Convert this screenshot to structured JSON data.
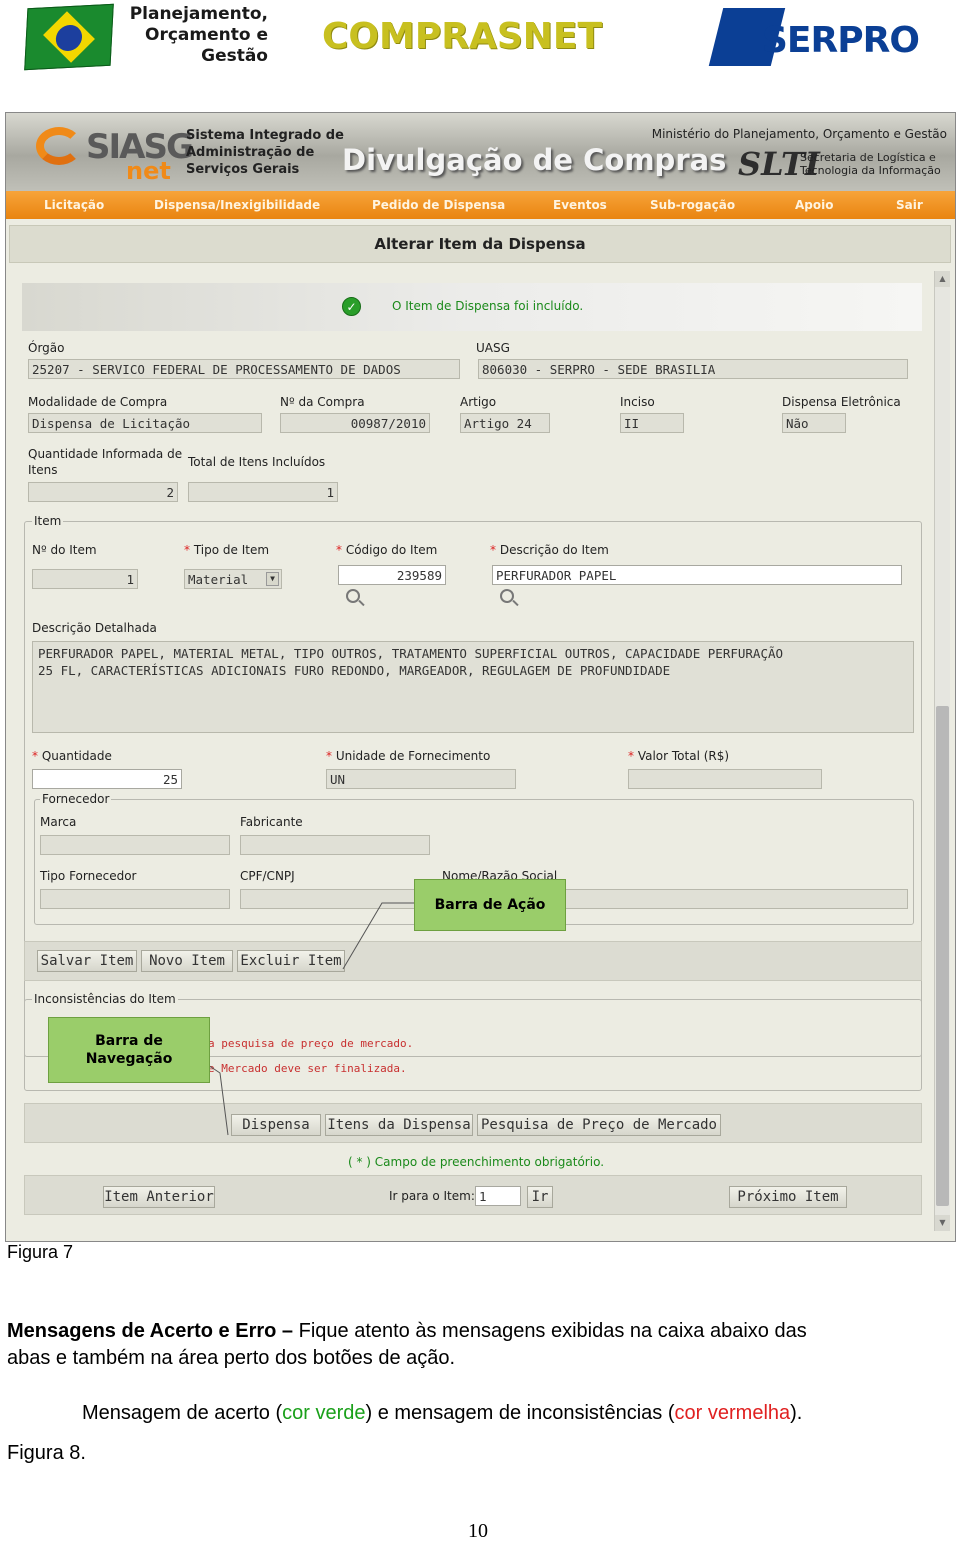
{
  "logos": {
    "mpog_lines": [
      "Planejamento,",
      "Orçamento e",
      "Gestão"
    ],
    "comprasnet": "COMPRASNET",
    "serpro": "SERPRO"
  },
  "banner": {
    "siasg": "SIASG",
    "net": "net",
    "system_name": [
      "Sistema Integrado de",
      "Administração de",
      "Serviços Gerais"
    ],
    "title": "Divulgação de Compras",
    "ministry": "Ministério do Planejamento, Orçamento e Gestão",
    "slti": "SLTI",
    "slti_sub": [
      "Secretaria de Logística e",
      "Tecnologia da Informação"
    ]
  },
  "menu": [
    "Licitação",
    "Dispensa/Inexigibilidade",
    "Pedido de Dispensa",
    "Eventos",
    "Sub-rogação",
    "Apoio",
    "Sair"
  ],
  "page_title": "Alterar Item da Dispensa",
  "success_message": "O Item de Dispensa foi incluído.",
  "form": {
    "orgao_label": "Órgão",
    "orgao_value": "25207 - SERVICO FEDERAL DE PROCESSAMENTO DE DADOS",
    "uasg_label": "UASG",
    "uasg_value": "806030 - SERPRO - SEDE BRASILIA",
    "modalidade_label": "Modalidade de Compra",
    "modalidade_value": "Dispensa de Licitação",
    "numero_label": "Nº da Compra",
    "numero_value": "00987/2010",
    "artigo_label": "Artigo",
    "artigo_value": "Artigo 24",
    "inciso_label": "Inciso",
    "inciso_value": "II",
    "eletronica_label": "Dispensa Eletrônica",
    "eletronica_value": "Não",
    "qtd_informada_label_1": "Quantidade Informada de",
    "qtd_informada_label_2": "Itens",
    "qtd_informada_value": "2",
    "total_incluidos_label": "Total de Itens Incluídos",
    "total_incluidos_value": "1",
    "item_legend": "Item",
    "num_item_label": "Nº do Item",
    "num_item_value": "1",
    "tipo_item_label": "Tipo de Item",
    "tipo_item_value": "Material",
    "codigo_item_label": "Código do Item",
    "codigo_item_value": "239589",
    "descricao_item_label": "Descrição do Item",
    "descricao_item_value": "PERFURADOR PAPEL",
    "descricao_detalhada_label": "Descrição Detalhada",
    "descricao_detalhada_line1": "PERFURADOR PAPEL, MATERIAL METAL, TIPO OUTROS, TRATAMENTO SUPERFICIAL OUTROS, CAPACIDADE PERFURAÇÃO",
    "descricao_detalhada_line2": "25 FL, CARACTERÍSTICAS ADICIONAIS FURO REDONDO, MARGEADOR, REGULAGEM DE PROFUNDIDADE",
    "quantidade_label": "Quantidade",
    "quantidade_value": "25",
    "unidade_label": "Unidade de Fornecimento",
    "unidade_value": "UN",
    "valor_label": "Valor Total (R$)",
    "valor_value": "",
    "fornecedor_legend": "Fornecedor",
    "marca_label": "Marca",
    "fabricante_label": "Fabricante",
    "tipo_fornecedor_label": "Tipo Fornecedor",
    "cpf_label": "CPF/CNPJ",
    "nome_label": "Nome/Razão Social",
    "required_mark": "*"
  },
  "actions": {
    "salvar": "Salvar Item",
    "novo": "Novo Item",
    "excluir": "Excluir Item"
  },
  "inconsistencias": {
    "legend": "Inconsistências do Item",
    "line1": "a pesquisa de preço de mercado.",
    "line2": "e Mercado deve ser finalizada."
  },
  "nav": {
    "dispensa": "Dispensa",
    "itens": "Itens da Dispensa",
    "pesquisa": "Pesquisa de Preço de Mercado"
  },
  "required_note": "( * ) Campo de preenchimento obrigatório.",
  "footer_nav": {
    "anterior": "Item Anterior",
    "ir_para_label": "Ir para o Item:",
    "ir_para_value": "1",
    "ir": "Ir",
    "proximo": "Próximo Item"
  },
  "callouts": {
    "acao": "Barra de Ação",
    "navegacao_1": "Barra de",
    "navegacao_2": "Navegação"
  },
  "doc": {
    "figura7": "Figura 7",
    "heading": "Mensagens de Acerto e Erro",
    "dash": " – ",
    "para_1": "Fique atento às mensagens exibidas na caixa abaixo das",
    "para_2": "abas e também na área perto dos botões de ação.",
    "msg_1": "Mensagem de acerto (",
    "msg_green": "cor verde",
    "msg_2": ") e mensagem de inconsistências (",
    "msg_red": "cor vermelha",
    "msg_3": ").",
    "figura8": "Figura 8.",
    "page_number": "10"
  },
  "colors": {
    "menu_orange": "#f09020",
    "success_green": "#1b8a1b",
    "error_red": "#c83030",
    "callout_green": "#9acd6a"
  }
}
